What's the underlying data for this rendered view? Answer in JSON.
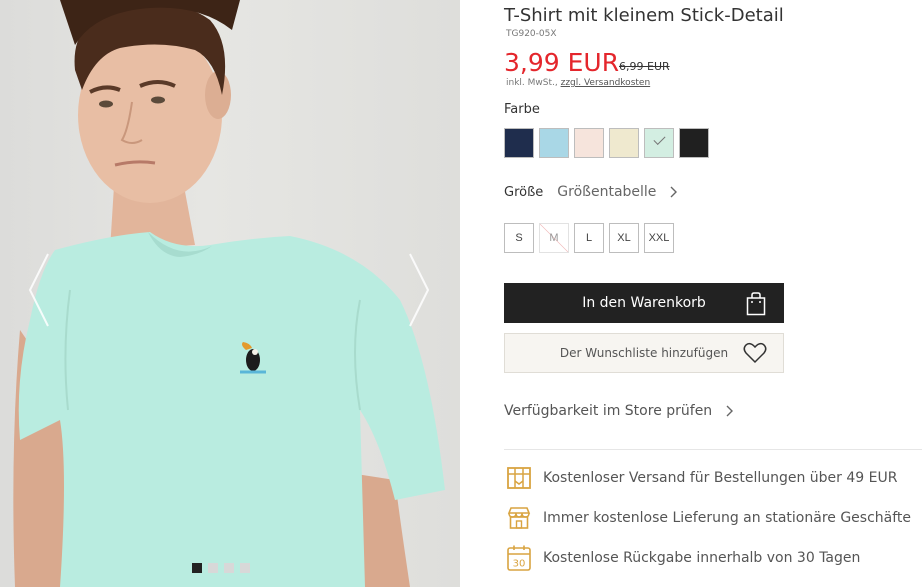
{
  "gallery": {
    "arrow_left": "‹",
    "arrow_right": "›",
    "dots_total": 4,
    "active_dot": 1
  },
  "product": {
    "title": "T-Shirt mit kleinem Stick-Detail",
    "sku": "TG920-05X",
    "price": "3,99 EUR",
    "old_price": "6,99 EUR",
    "tax_text": "inkl. MwSt., ",
    "shipping_link": "zzgl. Versandkosten"
  },
  "color": {
    "label": "Farbe",
    "swatches": [
      {
        "name": "navy",
        "color": "#1f2d4d",
        "selected": false
      },
      {
        "name": "light-blue",
        "color": "#a9d7e6",
        "selected": false
      },
      {
        "name": "pale-pink",
        "color": "#f6e4dc",
        "selected": false
      },
      {
        "name": "cream",
        "color": "#efe9cf",
        "selected": false
      },
      {
        "name": "mint",
        "color": "#d3eee2",
        "selected": true
      },
      {
        "name": "black",
        "color": "#202020",
        "selected": false
      }
    ]
  },
  "size": {
    "label": "Größe",
    "chart_link": "Größentabelle",
    "options": [
      {
        "label": "S",
        "available": true
      },
      {
        "label": "M",
        "available": false
      },
      {
        "label": "L",
        "available": true
      },
      {
        "label": "XL",
        "available": true
      },
      {
        "label": "XXL",
        "available": true
      }
    ]
  },
  "actions": {
    "add_to_cart": "In den Warenkorb",
    "wishlist": "Der Wunschliste hinzufügen",
    "store_availability": "Verfügbarkeit im Store prüfen"
  },
  "benefits": [
    {
      "icon": "shipping-box-icon",
      "text": "Kostenloser Versand für Bestellungen über 49 EUR"
    },
    {
      "icon": "store-icon",
      "text": "Immer kostenlose Lieferung an stationäre Geschäfte"
    },
    {
      "icon": "calendar-30-icon",
      "text": "Kostenlose Rückgabe innerhalb von 30 Tagen",
      "badge": "30"
    }
  ],
  "colors": {
    "accent_price": "#e4262c",
    "primary_button": "#222222",
    "benefit_icon": "#d9a441",
    "shirt": "#b9ece0"
  }
}
